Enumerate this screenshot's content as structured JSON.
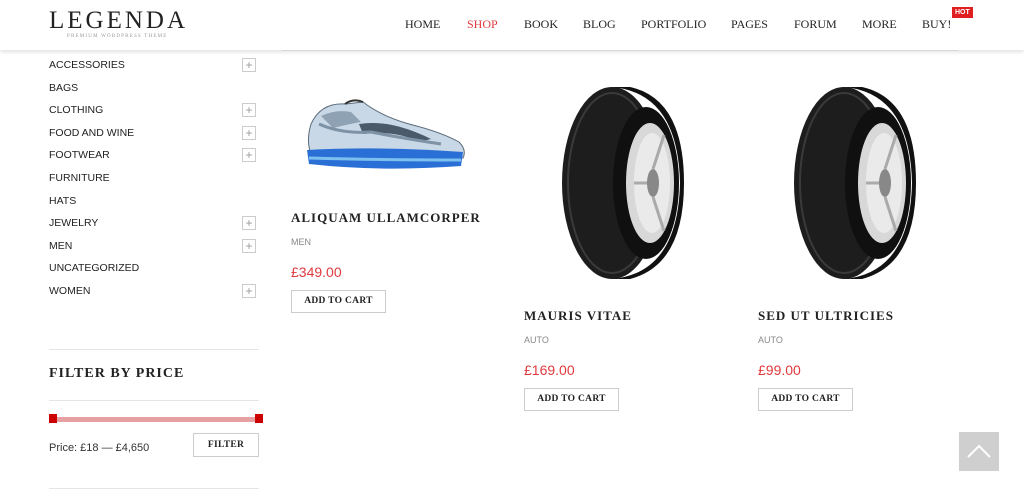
{
  "header": {
    "logo_title": "LEGENDA",
    "logo_subtitle": "PREMIUM WORDPRESS THEME",
    "nav": [
      "HOME",
      "SHOP",
      "BOOK",
      "BLOG",
      "PORTFOLIO",
      "PAGES",
      "FORUM",
      "MORE",
      "BUY!"
    ],
    "active_nav": "SHOP",
    "hot_badge": "HOT"
  },
  "sidebar": {
    "categories": [
      {
        "label": "ACCESSORIES",
        "expandable": true
      },
      {
        "label": "BAGS",
        "expandable": false
      },
      {
        "label": "CLOTHING",
        "expandable": true
      },
      {
        "label": "FOOD AND WINE",
        "expandable": true
      },
      {
        "label": "FOOTWEAR",
        "expandable": true
      },
      {
        "label": "FURNITURE",
        "expandable": false
      },
      {
        "label": "HATS",
        "expandable": false
      },
      {
        "label": "JEWELRY",
        "expandable": true
      },
      {
        "label": "MEN",
        "expandable": true
      },
      {
        "label": "UNCATEGORIZED",
        "expandable": false
      },
      {
        "label": "WOMEN",
        "expandable": true
      }
    ],
    "expand_symbol": "+",
    "filter_title": "FILTER BY PRICE",
    "price_label": "Price: £18 — £4,650",
    "filter_button": "FILTER",
    "price_min": 18,
    "price_max": 4650
  },
  "products": [
    {
      "name": "ALIQUAM ULLAMCORPER",
      "category": "MEN",
      "price": "£349.00",
      "button": "ADD TO CART",
      "image": "sneaker"
    },
    {
      "name": "MAURIS VITAE",
      "category": "AUTO",
      "price": "£169.00",
      "button": "ADD TO CART",
      "image": "tire"
    },
    {
      "name": "SED UT ULTRICIES",
      "category": "AUTO",
      "price": "£99.00",
      "button": "ADD TO CART",
      "image": "tire"
    }
  ],
  "colors": {
    "accent": "#e03a3e",
    "slider": "#c00000"
  },
  "scroll_top_icon": "chevron-up-icon"
}
